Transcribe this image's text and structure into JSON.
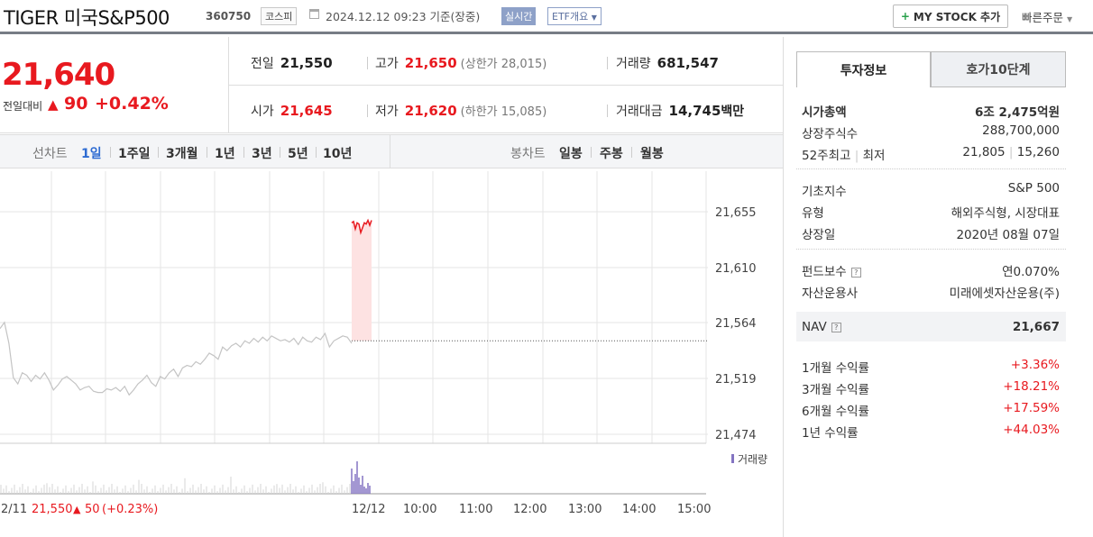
{
  "header": {
    "title": "TIGER 미국S&P500",
    "code": "360750",
    "market": "코스피",
    "date": "2024.12.12 09:23 기준(장중)",
    "realtime": "실시간",
    "etf_overview": "ETF개요",
    "mystock": "MY STOCK 추가",
    "quick_order": "빠른주문"
  },
  "price": {
    "now": "21,640",
    "change_label": "전일대비",
    "change": "90",
    "change_rate": "+0.42%",
    "prev_label": "전일",
    "prev": "21,550",
    "high_label": "고가",
    "high": "21,650",
    "upper_limit": "(상한가 28,015)",
    "volume_label": "거래량",
    "volume": "681,547",
    "open_label": "시가",
    "open": "21,645",
    "low_label": "저가",
    "low": "21,620",
    "lower_limit": "(하한가 15,085)",
    "amount_label": "거래대금",
    "amount": "14,745",
    "amount_unit": "백만"
  },
  "chart_tabs": {
    "line_chart": "선차트",
    "periods": [
      "1일",
      "1주일",
      "3개월",
      "1년",
      "3년",
      "5년",
      "10년"
    ],
    "candle_chart": "봉차트",
    "candles": [
      "일봉",
      "주봉",
      "월봉"
    ]
  },
  "chart_data": {
    "type": "line",
    "y_ticks": [
      "21,655",
      "21,610",
      "21,564",
      "21,519",
      "21,474"
    ],
    "ylim": [
      21474,
      21655
    ],
    "x_ticks": [
      "2/11",
      "12/12",
      "10:00",
      "11:00",
      "12:00",
      "13:00",
      "14:00",
      "15:00"
    ],
    "prev_day_info": {
      "close": "21,550",
      "change": "50",
      "rate": "(+0.23%)"
    },
    "volume_label": "거래량",
    "series": [
      {
        "values": [
          21560,
          21565,
          21548,
          21520,
          21515,
          21524,
          21522,
          21517,
          21522,
          21519,
          21524,
          21518,
          21510,
          21514,
          21519,
          21521,
          21518,
          21515,
          21510,
          21512,
          21513,
          21509,
          21508,
          21508,
          21511,
          21510,
          21512,
          21509,
          21513,
          21506,
          21510,
          21515,
          21518,
          21522,
          21516,
          21513,
          21521,
          21519,
          21524,
          21527,
          21521,
          21528,
          21530,
          21529,
          21533,
          21531,
          21535,
          21540,
          21538,
          21535,
          21545,
          21542,
          21546,
          21548,
          21545,
          21550,
          21548,
          21552,
          21549,
          21553,
          21550,
          21554,
          21552,
          21550,
          21551,
          21549,
          21552,
          21547,
          21553,
          21550,
          21549,
          21553,
          21551,
          21556,
          21545,
          21550,
          21552,
          21554,
          21553,
          21548
        ]
      },
      {
        "values": [
          21646,
          21647,
          21641,
          21646,
          21645,
          21638,
          21642,
          21646,
          21645,
          21648,
          21644,
          21648
        ]
      }
    ],
    "prev_close_value": 21550
  },
  "side": {
    "tab_invest": "투자정보",
    "tab_order": "호가10단계",
    "rows": [
      {
        "k": "시가총액",
        "v": "6조 2,475억원"
      },
      {
        "k": "상장주식수",
        "v": "288,700,000"
      },
      {
        "k": "52주최고",
        "k2": "최저",
        "v": "21,805",
        "v2": "15,260"
      },
      {
        "k": "기초지수",
        "v": "S&P 500"
      },
      {
        "k": "유형",
        "v": "해외주식형, 시장대표"
      },
      {
        "k": "상장일",
        "v": "2020년 08월 07일"
      },
      {
        "k": "펀드보수",
        "v": "연0.070%"
      },
      {
        "k": "자산운용사",
        "v": "미래에셋자산운용(주)"
      },
      {
        "k": "NAV",
        "v": "21,667"
      },
      {
        "k": "1개월 수익률",
        "v": "+3.36%"
      },
      {
        "k": "3개월 수익률",
        "v": "+18.21%"
      },
      {
        "k": "6개월 수익률",
        "v": "+17.59%"
      },
      {
        "k": "1년 수익률",
        "v": "+44.03%"
      }
    ]
  },
  "colors": {
    "up": "#e8191f",
    "link": "#2d6bd2",
    "line": "#c8c8c8",
    "volume": "#a89ad0"
  }
}
